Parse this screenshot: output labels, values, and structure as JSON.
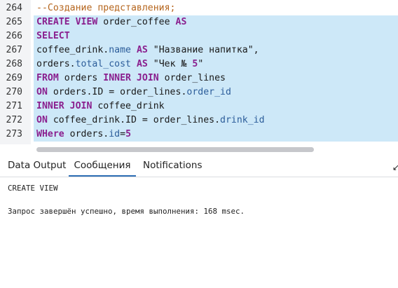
{
  "editor": {
    "lines": [
      {
        "num": "264",
        "selected": false,
        "tokens": [
          {
            "t": "--Создание представления;",
            "c": "cm"
          }
        ]
      },
      {
        "num": "265",
        "selected": true,
        "tokens": [
          {
            "t": "CREATE VIEW",
            "c": "kw"
          },
          {
            "t": " order_coffee ",
            "c": "pl"
          },
          {
            "t": "AS",
            "c": "kw"
          }
        ]
      },
      {
        "num": "266",
        "selected": true,
        "tokens": [
          {
            "t": "SELECT",
            "c": "kw"
          }
        ]
      },
      {
        "num": "267",
        "selected": true,
        "tokens": [
          {
            "t": "coffee_drink.",
            "c": "pl"
          },
          {
            "t": "name",
            "c": "fd"
          },
          {
            "t": " ",
            "c": "pl"
          },
          {
            "t": "AS",
            "c": "kw"
          },
          {
            "t": " \"Название напитка\",",
            "c": "st"
          }
        ]
      },
      {
        "num": "268",
        "selected": true,
        "tokens": [
          {
            "t": "orders.",
            "c": "pl"
          },
          {
            "t": "total_cost",
            "c": "fd"
          },
          {
            "t": " ",
            "c": "pl"
          },
          {
            "t": "AS",
            "c": "kw"
          },
          {
            "t": " \"Чек № ",
            "c": "st"
          },
          {
            "t": "5",
            "c": "nm"
          },
          {
            "t": "\"",
            "c": "st"
          }
        ]
      },
      {
        "num": "269",
        "selected": true,
        "tokens": [
          {
            "t": "FROM",
            "c": "kw"
          },
          {
            "t": " orders ",
            "c": "pl"
          },
          {
            "t": "INNER JOIN",
            "c": "kw"
          },
          {
            "t": " order_lines",
            "c": "pl"
          }
        ]
      },
      {
        "num": "270",
        "selected": true,
        "tokens": [
          {
            "t": "ON",
            "c": "kw"
          },
          {
            "t": " orders.ID = order_lines.",
            "c": "pl"
          },
          {
            "t": "order_id",
            "c": "fd"
          }
        ]
      },
      {
        "num": "271",
        "selected": true,
        "tokens": [
          {
            "t": "INNER JOIN",
            "c": "kw"
          },
          {
            "t": " coffee_drink",
            "c": "pl"
          }
        ]
      },
      {
        "num": "272",
        "selected": true,
        "tokens": [
          {
            "t": "ON",
            "c": "kw"
          },
          {
            "t": " coffee_drink.ID = order_lines.",
            "c": "pl"
          },
          {
            "t": "drink_id",
            "c": "fd"
          }
        ]
      },
      {
        "num": "273",
        "selected": true,
        "tokens": [
          {
            "t": "WHere",
            "c": "kw"
          },
          {
            "t": " orders.",
            "c": "pl"
          },
          {
            "t": "id",
            "c": "fd"
          },
          {
            "t": "=",
            "c": "pl"
          },
          {
            "t": "5",
            "c": "nm"
          }
        ]
      }
    ]
  },
  "tabs": {
    "data_output": "Data Output",
    "messages": "Сообщения",
    "notifications": "Notifications"
  },
  "output": {
    "line1": "CREATE VIEW",
    "line2": "Запрос завершён успешно, время выполнения: 168 msec."
  },
  "icons": {
    "corner": "↙"
  }
}
